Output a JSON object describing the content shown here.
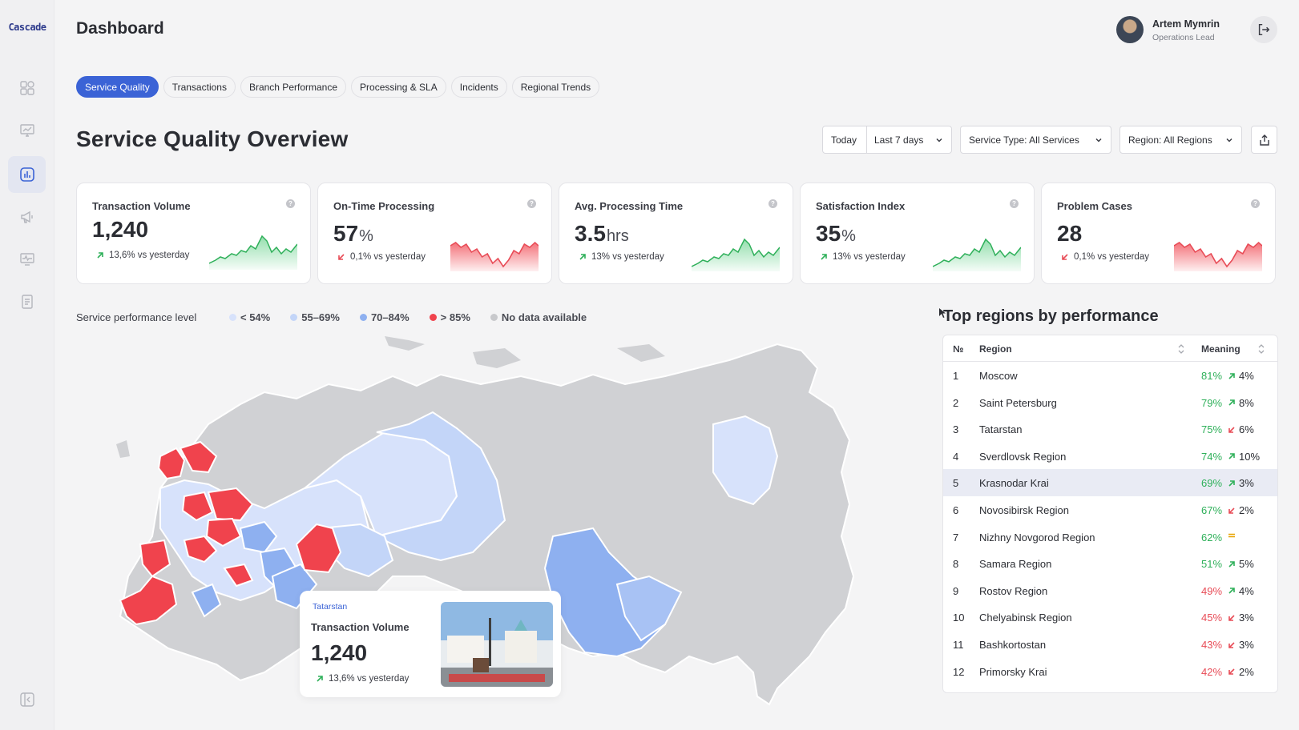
{
  "app": {
    "logo": "Cascade",
    "page_title": "Dashboard"
  },
  "user": {
    "name": "Artem Mymrin",
    "role": "Operations Lead"
  },
  "tabs": [
    {
      "label": "Service Quality",
      "active": true
    },
    {
      "label": "Transactions",
      "active": false
    },
    {
      "label": "Branch Performance",
      "active": false
    },
    {
      "label": "Processing & SLA",
      "active": false
    },
    {
      "label": "Incidents",
      "active": false
    },
    {
      "label": "Regional Trends",
      "active": false
    }
  ],
  "section_title": "Service Quality Overview",
  "filters": {
    "today": "Today",
    "period": "Last 7 days",
    "service_type": "Service Type: All Services",
    "region": "Region: All Regions"
  },
  "kpis": [
    {
      "title": "Transaction Volume",
      "value": "1,240",
      "unit": "",
      "delta": "13,6% vs yesterday",
      "trend": "up"
    },
    {
      "title": "On-Time Processing",
      "value": "57",
      "unit": "%",
      "delta": "0,1% vs yesterday",
      "trend": "down"
    },
    {
      "title": "Avg. Processing Time",
      "value": "3.5",
      "unit": "hrs",
      "delta": "13% vs yesterday",
      "trend": "up"
    },
    {
      "title": "Satisfaction Index",
      "value": "35",
      "unit": "%",
      "delta": "13% vs yesterday",
      "trend": "up"
    },
    {
      "title": "Problem Cases",
      "value": "28",
      "unit": "",
      "delta": "0,1% vs yesterday",
      "trend": "down"
    }
  ],
  "legend": {
    "label": "Service performance level",
    "items": [
      {
        "label": "< 54%",
        "color": "#d7e2fb"
      },
      {
        "label": "55–69%",
        "color": "#c3d5f8"
      },
      {
        "label": "70–84%",
        "color": "#8eb0f0"
      },
      {
        "label": "> 85%",
        "color": "#f0434d"
      },
      {
        "label": "No data available",
        "color": "#c8c9cc"
      }
    ]
  },
  "popup": {
    "region": "Tatarstan",
    "title": "Transaction Volume",
    "value": "1,240",
    "delta": "13,6% vs yesterday"
  },
  "table": {
    "title": "Top regions by performance",
    "headers": {
      "no": "№",
      "region": "Region",
      "meaning": "Meaning"
    },
    "rows": [
      {
        "no": "1",
        "region": "Moscow",
        "pct": "81%",
        "change": "4%",
        "dir": "up"
      },
      {
        "no": "2",
        "region": "Saint Petersburg",
        "pct": "79%",
        "change": "8%",
        "dir": "up"
      },
      {
        "no": "3",
        "region": "Tatarstan",
        "pct": "75%",
        "change": "6%",
        "dir": "down"
      },
      {
        "no": "4",
        "region": "Sverdlovsk Region",
        "pct": "74%",
        "change": "10%",
        "dir": "up"
      },
      {
        "no": "5",
        "region": "Krasnodar Krai",
        "pct": "69%",
        "change": "3%",
        "dir": "up"
      },
      {
        "no": "6",
        "region": "Novosibirsk Region",
        "pct": "67%",
        "change": "2%",
        "dir": "down"
      },
      {
        "no": "7",
        "region": "Nizhny Novgorod Region",
        "pct": "62%",
        "change": "",
        "dir": "flat"
      },
      {
        "no": "8",
        "region": "Samara Region",
        "pct": "51%",
        "change": "5%",
        "dir": "up"
      },
      {
        "no": "9",
        "region": "Rostov Region",
        "pct": "49%",
        "change": "4%",
        "dir": "up"
      },
      {
        "no": "10",
        "region": "Chelyabinsk Region",
        "pct": "45%",
        "change": "3%",
        "dir": "down"
      },
      {
        "no": "11",
        "region": "Bashkortostan",
        "pct": "43%",
        "change": "3%",
        "dir": "down"
      },
      {
        "no": "12",
        "region": "Primorsky Krai",
        "pct": "42%",
        "change": "2%",
        "dir": "down"
      }
    ]
  },
  "colors": {
    "accent": "#3b63d6",
    "up": "#2fb05a",
    "down": "#e84c57",
    "flat": "#e8a200"
  },
  "icons": [
    "dashboard-icon",
    "presentation-icon",
    "chart-icon",
    "megaphone-icon",
    "monitor-icon",
    "document-icon",
    "collapse-icon",
    "logout-icon",
    "share-icon",
    "chevron-down-icon",
    "help-icon",
    "sort-icon"
  ]
}
